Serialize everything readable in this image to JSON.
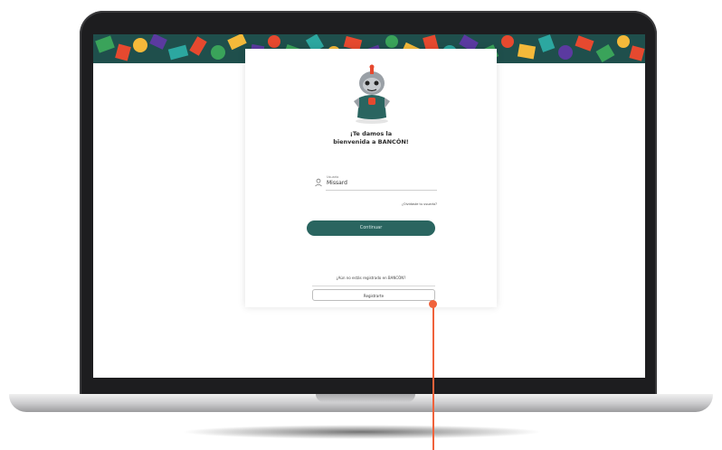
{
  "welcome": {
    "line1": "¡Te damos la",
    "line2": "bienvenida a BANCÓN!"
  },
  "login": {
    "user_label": "Usuario",
    "user_value": "Missard",
    "forgot_link": "¿Olvidaste tu usuario?",
    "continue_label": "Continuar"
  },
  "signup": {
    "question": "¿Aún no estás registrado en BANCÓN?",
    "register_label": "Registrarte"
  },
  "colors": {
    "accent": "#2a6560",
    "callout": "#f0623b"
  }
}
